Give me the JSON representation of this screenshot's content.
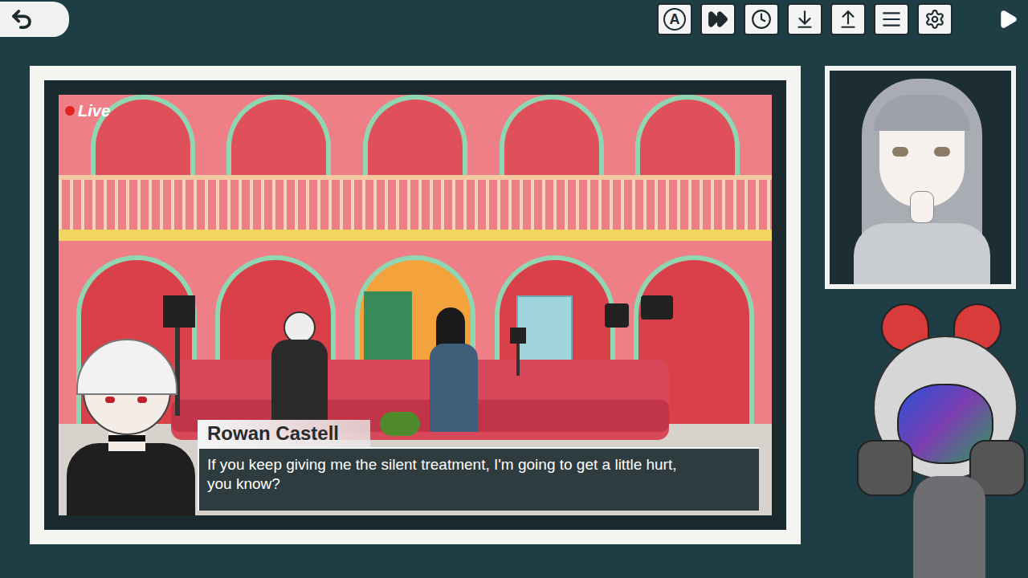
{
  "toolbar_buttons": [
    {
      "kind": "auto",
      "label": "A"
    },
    {
      "kind": "skip"
    },
    {
      "kind": "log"
    },
    {
      "kind": "save"
    },
    {
      "kind": "load"
    },
    {
      "kind": "menu"
    },
    {
      "kind": "settings"
    }
  ],
  "scene": {
    "live": {
      "label": "Live"
    }
  },
  "dialogue": {
    "speaker": "Rowan Castell",
    "text": "If you keep giving me the silent treatment, I'm going to get a little hurt, you know?"
  }
}
